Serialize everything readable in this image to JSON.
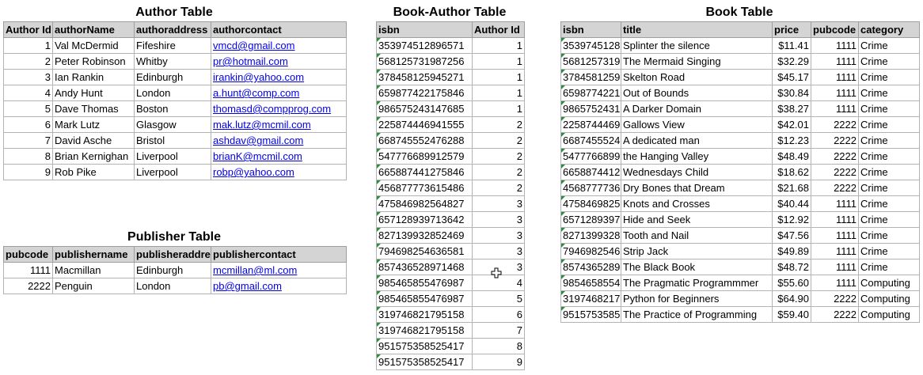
{
  "author_table": {
    "title": "Author Table",
    "headers": [
      "Author Id",
      "authorName",
      "authoraddress",
      "authorcontact"
    ],
    "rows": [
      [
        "1",
        "Val McDermid",
        "Fifeshire",
        "vmcd@gmail.com"
      ],
      [
        "2",
        "Peter Robinson",
        "Whitby",
        "pr@hotmail.com"
      ],
      [
        "3",
        "Ian Rankin",
        "Edinburgh",
        "irankin@yahoo.com"
      ],
      [
        "4",
        "Andy Hunt",
        "London",
        "a.hunt@comp.com"
      ],
      [
        "5",
        "Dave Thomas",
        "Boston",
        "thomasd@compprog.com"
      ],
      [
        "6",
        "Mark Lutz",
        "Glasgow",
        "mak.lutz@mcmil.com"
      ],
      [
        "7",
        "David Asche",
        "Bristol",
        "ashdav@gmail.com"
      ],
      [
        "8",
        "Brian Kernighan",
        "Liverpool",
        "brianK@mcmil.com"
      ],
      [
        "9",
        "Rob Pike",
        "Liverpool",
        "robp@yahoo.com"
      ]
    ]
  },
  "publisher_table": {
    "title": "Publisher Table",
    "headers": [
      "pubcode",
      "publishername",
      "publisheraddre",
      "publishercontact"
    ],
    "rows": [
      [
        "1111",
        "Macmillan",
        "Edinburgh",
        "mcmillan@ml.com"
      ],
      [
        "2222",
        "Penguin",
        "London",
        "pb@gmail.com"
      ]
    ]
  },
  "book_author_table": {
    "title": "Book-Author Table",
    "headers": [
      "isbn",
      "Author Id"
    ],
    "rows": [
      [
        "353974512896571",
        "1"
      ],
      [
        "568125731987256",
        "1"
      ],
      [
        "378458125945271",
        "1"
      ],
      [
        "659877422175846",
        "1"
      ],
      [
        "986575243147685",
        "1"
      ],
      [
        "225874446941555",
        "2"
      ],
      [
        "668745552476288",
        "2"
      ],
      [
        "547776689912579",
        "2"
      ],
      [
        "665887441275846",
        "2"
      ],
      [
        "456877773615486",
        "2"
      ],
      [
        "475846982564827",
        "3"
      ],
      [
        "657128939713642",
        "3"
      ],
      [
        "827139932852469",
        "3"
      ],
      [
        "794698254636581",
        "3"
      ],
      [
        "857436528971468",
        "3"
      ],
      [
        "985465855476987",
        "4"
      ],
      [
        "985465855476987",
        "5"
      ],
      [
        "319746821795158",
        "6"
      ],
      [
        "319746821795158",
        "7"
      ],
      [
        "951575358525417",
        "8"
      ],
      [
        "951575358525417",
        "9"
      ]
    ]
  },
  "book_table": {
    "title": "Book Table",
    "headers": [
      "isbn",
      "title",
      "price",
      "pubcode",
      "category"
    ],
    "rows": [
      [
        "3539745128",
        "Splinter the silence",
        "$11.41",
        "1111",
        "Crime"
      ],
      [
        "5681257319",
        "The Mermaid Singing",
        "$32.29",
        "1111",
        "Crime"
      ],
      [
        "3784581259",
        "Skelton Road",
        "$45.17",
        "1111",
        "Crime"
      ],
      [
        "6598774221",
        "Out of Bounds",
        "$30.84",
        "1111",
        "Crime"
      ],
      [
        "9865752431",
        "A Darker Domain",
        "$38.27",
        "1111",
        "Crime"
      ],
      [
        "2258744469",
        "Gallows View",
        "$42.01",
        "2222",
        "Crime"
      ],
      [
        "6687455524",
        "A dedicated man",
        "$12.23",
        "2222",
        "Crime"
      ],
      [
        "5477766899",
        "the Hanging Valley",
        "$48.49",
        "2222",
        "Crime"
      ],
      [
        "6658874412",
        "Wednesdays Child",
        "$18.62",
        "2222",
        "Crime"
      ],
      [
        "4568777736",
        "Dry Bones that Dream",
        "$21.68",
        "2222",
        "Crime"
      ],
      [
        "4758469825",
        "Knots and Crosses",
        "$40.44",
        "1111",
        "Crime"
      ],
      [
        "6571289397",
        "Hide and Seek",
        "$12.92",
        "1111",
        "Crime"
      ],
      [
        "8271399328",
        "Tooth and Nail",
        "$47.56",
        "1111",
        "Crime"
      ],
      [
        "7946982546",
        "Strip Jack",
        "$49.89",
        "1111",
        "Crime"
      ],
      [
        "8574365289",
        "The Black Book",
        "$48.72",
        "1111",
        "Crime"
      ],
      [
        "9854658554",
        "The Pragmatic Programmmer",
        "$55.60",
        "1111",
        "Computing"
      ],
      [
        "3197468217",
        "Python for Beginners",
        "$64.90",
        "2222",
        "Computing"
      ],
      [
        "9515753585",
        "The Practice of Programming",
        "$59.40",
        "2222",
        "Computing"
      ]
    ]
  },
  "cursor_icon": "move-cursor-icon",
  "colors": {
    "header_bg": "#d4d4d4",
    "link": "#0000ee",
    "triangle": "#2e8b3e",
    "border": "#b3b3b3"
  }
}
